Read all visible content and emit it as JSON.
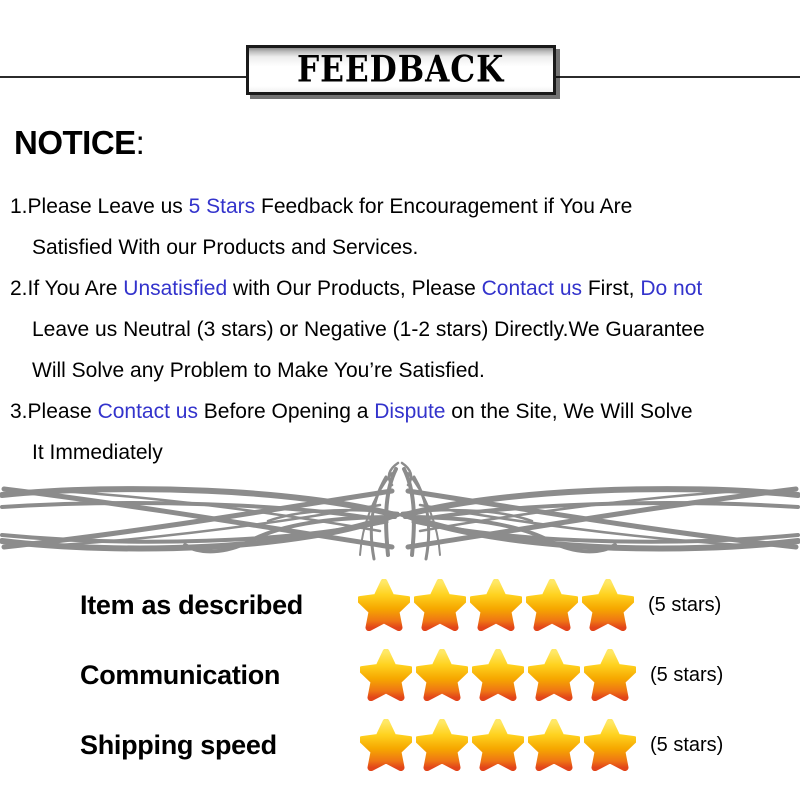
{
  "header": {
    "banner_title": "FEEDBACK",
    "divider_color": "#2b2b2b"
  },
  "notice": {
    "heading": "NOTICE",
    "heading_colon": ":",
    "accent_color": "#3333cc",
    "items": [
      {
        "number": "1.",
        "lines": [
          [
            {
              "text": "Please Leave us ",
              "color": "black"
            },
            {
              "text": " 5 Stars ",
              "color": "blue"
            },
            {
              "text": " Feedback for  Encouragement  if You Are",
              "color": "black"
            }
          ],
          [
            {
              "text": "Satisfied With our Products and Services.",
              "color": "black"
            }
          ]
        ]
      },
      {
        "number": "2.",
        "lines": [
          [
            {
              "text": "If You Are ",
              "color": "black"
            },
            {
              "text": "Unsatisfied",
              "color": "blue"
            },
            {
              "text": " with Our Products, Please ",
              "color": "black"
            },
            {
              "text": "Contact us",
              "color": "blue"
            },
            {
              "text": " First, ",
              "color": "black"
            },
            {
              "text": "Do not",
              "color": "blue"
            }
          ],
          [
            {
              "text": "Leave us Neutral (3 stars) or Negative (1-2 stars) Directly.We Guarantee",
              "color": "black"
            }
          ],
          [
            {
              "text": "Will Solve any Problem to Make You’re  Satisfied.",
              "color": "black"
            }
          ]
        ]
      },
      {
        "number": "3.",
        "lines": [
          [
            {
              "text": "Please ",
              "color": "black"
            },
            {
              "text": "Contact us",
              "color": "blue"
            },
            {
              "text": " Before Opening a ",
              "color": "black"
            },
            {
              "text": "Dispute",
              "color": "blue"
            },
            {
              "text": " on the Site, We Will Solve",
              "color": "black"
            }
          ],
          [
            {
              "text": "It Immediately",
              "color": "black"
            }
          ]
        ]
      }
    ]
  },
  "ornament": {
    "color": "#8c8c8c"
  },
  "ratings": {
    "star_colors": {
      "top": "#ffe14d",
      "mid": "#f5b50a",
      "bottom": "#e8621a"
    },
    "rows": [
      {
        "label": "Item as described",
        "stars": 5,
        "note": "(5 stars)"
      },
      {
        "label": "Communication",
        "stars": 5,
        "note": "(5 stars)"
      },
      {
        "label": "Shipping speed",
        "stars": 5,
        "note": "(5 stars)"
      }
    ]
  }
}
